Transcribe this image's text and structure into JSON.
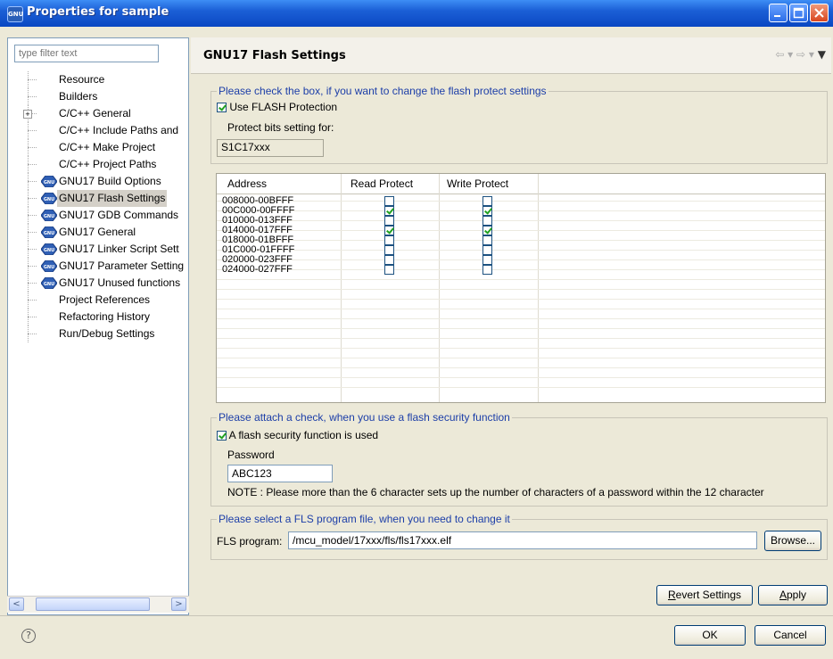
{
  "window": {
    "title": "Properties for sample"
  },
  "filter": {
    "placeholder": "type filter text"
  },
  "tree": {
    "items": [
      {
        "label": "Resource",
        "gnu": false,
        "expandable": false
      },
      {
        "label": "Builders",
        "gnu": false,
        "expandable": false
      },
      {
        "label": "C/C++ General",
        "gnu": false,
        "expandable": true
      },
      {
        "label": "C/C++ Include Paths and",
        "gnu": false,
        "expandable": false
      },
      {
        "label": "C/C++ Make Project",
        "gnu": false,
        "expandable": false
      },
      {
        "label": "C/C++ Project Paths",
        "gnu": false,
        "expandable": false
      },
      {
        "label": "GNU17 Build Options",
        "gnu": true,
        "expandable": false
      },
      {
        "label": "GNU17 Flash Settings",
        "gnu": true,
        "expandable": false,
        "selected": true
      },
      {
        "label": "GNU17 GDB Commands",
        "gnu": true,
        "expandable": false
      },
      {
        "label": "GNU17 General",
        "gnu": true,
        "expandable": false
      },
      {
        "label": "GNU17 Linker Script Sett",
        "gnu": true,
        "expandable": false
      },
      {
        "label": "GNU17 Parameter Setting",
        "gnu": true,
        "expandable": false
      },
      {
        "label": "GNU17 Unused functions",
        "gnu": true,
        "expandable": false
      },
      {
        "label": "Project References",
        "gnu": false,
        "expandable": false
      },
      {
        "label": "Refactoring History",
        "gnu": false,
        "expandable": false
      },
      {
        "label": "Run/Debug Settings",
        "gnu": false,
        "expandable": false
      }
    ]
  },
  "page": {
    "title": "GNU17 Flash Settings",
    "protect_group": {
      "legend": "Please check the box, if you want to change the flash protect settings",
      "use_flash_label": "Use FLASH Protection",
      "use_flash_checked": true,
      "protect_bits_label": "Protect bits setting for:",
      "protect_bits_value": "S1C17xxx"
    },
    "table": {
      "headers": [
        "Address",
        "Read Protect",
        "Write Protect"
      ],
      "rows": [
        {
          "address": "008000-00BFFF",
          "read": false,
          "write": false
        },
        {
          "address": "00C000-00FFFF",
          "read": true,
          "write": true
        },
        {
          "address": "010000-013FFF",
          "read": false,
          "write": false
        },
        {
          "address": "014000-017FFF",
          "read": true,
          "write": true
        },
        {
          "address": "018000-01BFFF",
          "read": false,
          "write": false
        },
        {
          "address": "01C000-01FFFF",
          "read": false,
          "write": false
        },
        {
          "address": "020000-023FFF",
          "read": false,
          "write": false
        },
        {
          "address": "024000-027FFF",
          "read": false,
          "write": false
        }
      ]
    },
    "security_group": {
      "legend": "Please attach a check, when you use a flash security function",
      "use_label": "A flash security function is used",
      "use_checked": true,
      "password_label": "Password",
      "password_value": "ABC123",
      "note": "NOTE : Please more than the 6 character sets up the number of characters of a password within the 12 character"
    },
    "fls_group": {
      "legend": "Please select a FLS program file, when you need to change it",
      "label": "FLS program:",
      "value": "/mcu_model/17xxx/fls/fls17xxx.elf",
      "browse_label": "Browse..."
    },
    "revert_label": "Revert Settings",
    "apply_label": "Apply"
  },
  "bottom": {
    "ok_label": "OK",
    "cancel_label": "Cancel"
  }
}
